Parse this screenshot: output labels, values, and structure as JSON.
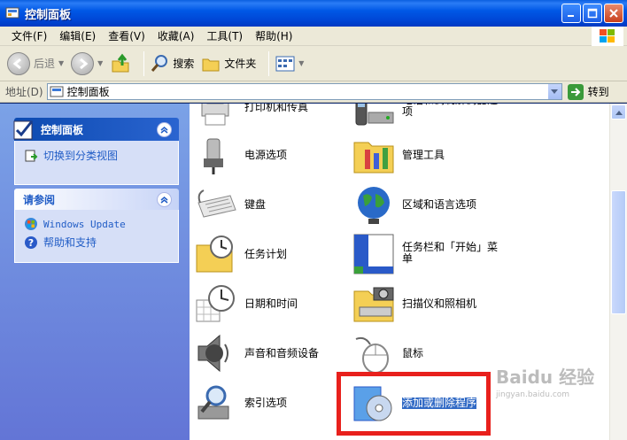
{
  "window": {
    "title": "控制面板"
  },
  "menu": [
    "文件(F)",
    "编辑(E)",
    "查看(V)",
    "收藏(A)",
    "工具(T)",
    "帮助(H)"
  ],
  "toolbar": {
    "back": "后退",
    "search": "搜索",
    "folders": "文件夹"
  },
  "address": {
    "label": "地址(D)",
    "value": "控制面板",
    "go": "转到"
  },
  "left": {
    "panel1": {
      "title": "控制面板",
      "link": "切换到分类视图"
    },
    "panel2": {
      "title": "请参阅",
      "links": [
        "Windows Update",
        "帮助和支持"
      ]
    }
  },
  "items": [
    {
      "label": "打印机和传真",
      "icon": "printer-icon"
    },
    {
      "label": "电话和调制解调器选项",
      "icon": "phone-modem-icon"
    },
    {
      "label": "电源选项",
      "icon": "power-icon"
    },
    {
      "label": "管理工具",
      "icon": "admin-tools-icon"
    },
    {
      "label": "键盘",
      "icon": "keyboard-icon"
    },
    {
      "label": "区域和语言选项",
      "icon": "globe-icon"
    },
    {
      "label": "任务计划",
      "icon": "scheduled-tasks-icon"
    },
    {
      "label": "任务栏和「开始」菜单",
      "icon": "taskbar-icon"
    },
    {
      "label": "日期和时间",
      "icon": "clock-icon"
    },
    {
      "label": "扫描仪和照相机",
      "icon": "scanner-camera-icon"
    },
    {
      "label": "声音和音频设备",
      "icon": "speaker-icon"
    },
    {
      "label": "鼠标",
      "icon": "mouse-icon"
    },
    {
      "label": "索引选项",
      "icon": "indexing-icon"
    },
    {
      "label": "添加或删除程序",
      "icon": "add-remove-programs-icon"
    }
  ],
  "watermark": {
    "brand": "Baidu 经验",
    "url": "jingyan.baidu.com"
  },
  "colors": {
    "highlight": "#e8201c",
    "selection": "#316ac5"
  }
}
